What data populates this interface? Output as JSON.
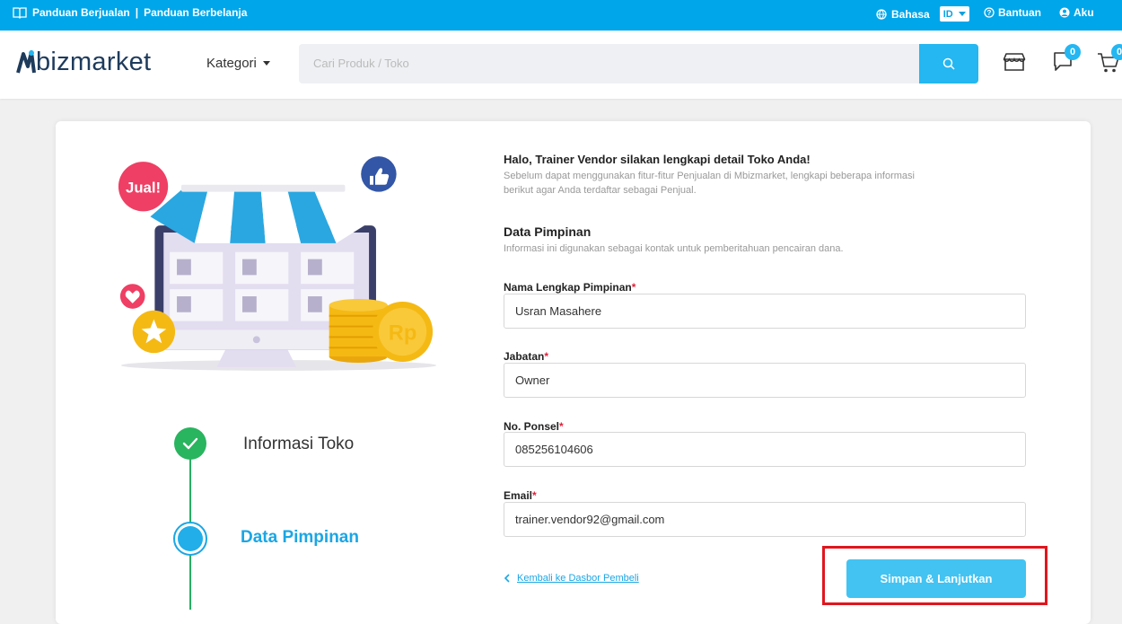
{
  "topbar": {
    "guide_seller": "Panduan Berjualan",
    "separator": "|",
    "guide_buyer": "Panduan Berbelanja",
    "language_label": "Bahasa",
    "language_value": "ID",
    "help_label": "Bantuan",
    "account_label": "Aku"
  },
  "header": {
    "logo_text": "bizmarket",
    "category_label": "Kategori",
    "search_placeholder": "Cari Produk / Toko",
    "chat_badge": "0",
    "cart_badge": "0"
  },
  "illustration": {
    "sell_badge": "Jual!",
    "coin_label": "Rp"
  },
  "steps": [
    {
      "label": "Informasi Toko",
      "status": "completed"
    },
    {
      "label": "Data Pimpinan",
      "status": "active"
    }
  ],
  "form": {
    "greeting": "Halo, Trainer Vendor silakan lengkapi detail Toko Anda!",
    "description": "Sebelum dapat menggunakan fitur-fitur Penjualan di Mbizmarket, lengkapi beberapa informasi berikut agar Anda terdaftar sebagai Penjual.",
    "section_title": "Data Pimpinan",
    "section_desc": "Informasi ini digunakan sebagai kontak untuk pemberitahuan pencairan dana.",
    "required_mark": "*",
    "fields": {
      "name": {
        "label": "Nama Lengkap Pimpinan",
        "value": "Usran Masahere"
      },
      "position": {
        "label": "Jabatan",
        "value": "Owner"
      },
      "phone": {
        "label": "No. Ponsel",
        "value": "085256104606"
      },
      "email": {
        "label": "Email",
        "value": "trainer.vendor92@gmail.com"
      }
    },
    "back_link": "Kembali ke Dasbor Pembeli",
    "submit_label": "Simpan & Lanjutkan"
  },
  "colors": {
    "brand_blue": "#00a6ea",
    "button_blue": "#42c3f2",
    "success_green": "#29b45f",
    "highlight_red": "#e0161e"
  }
}
